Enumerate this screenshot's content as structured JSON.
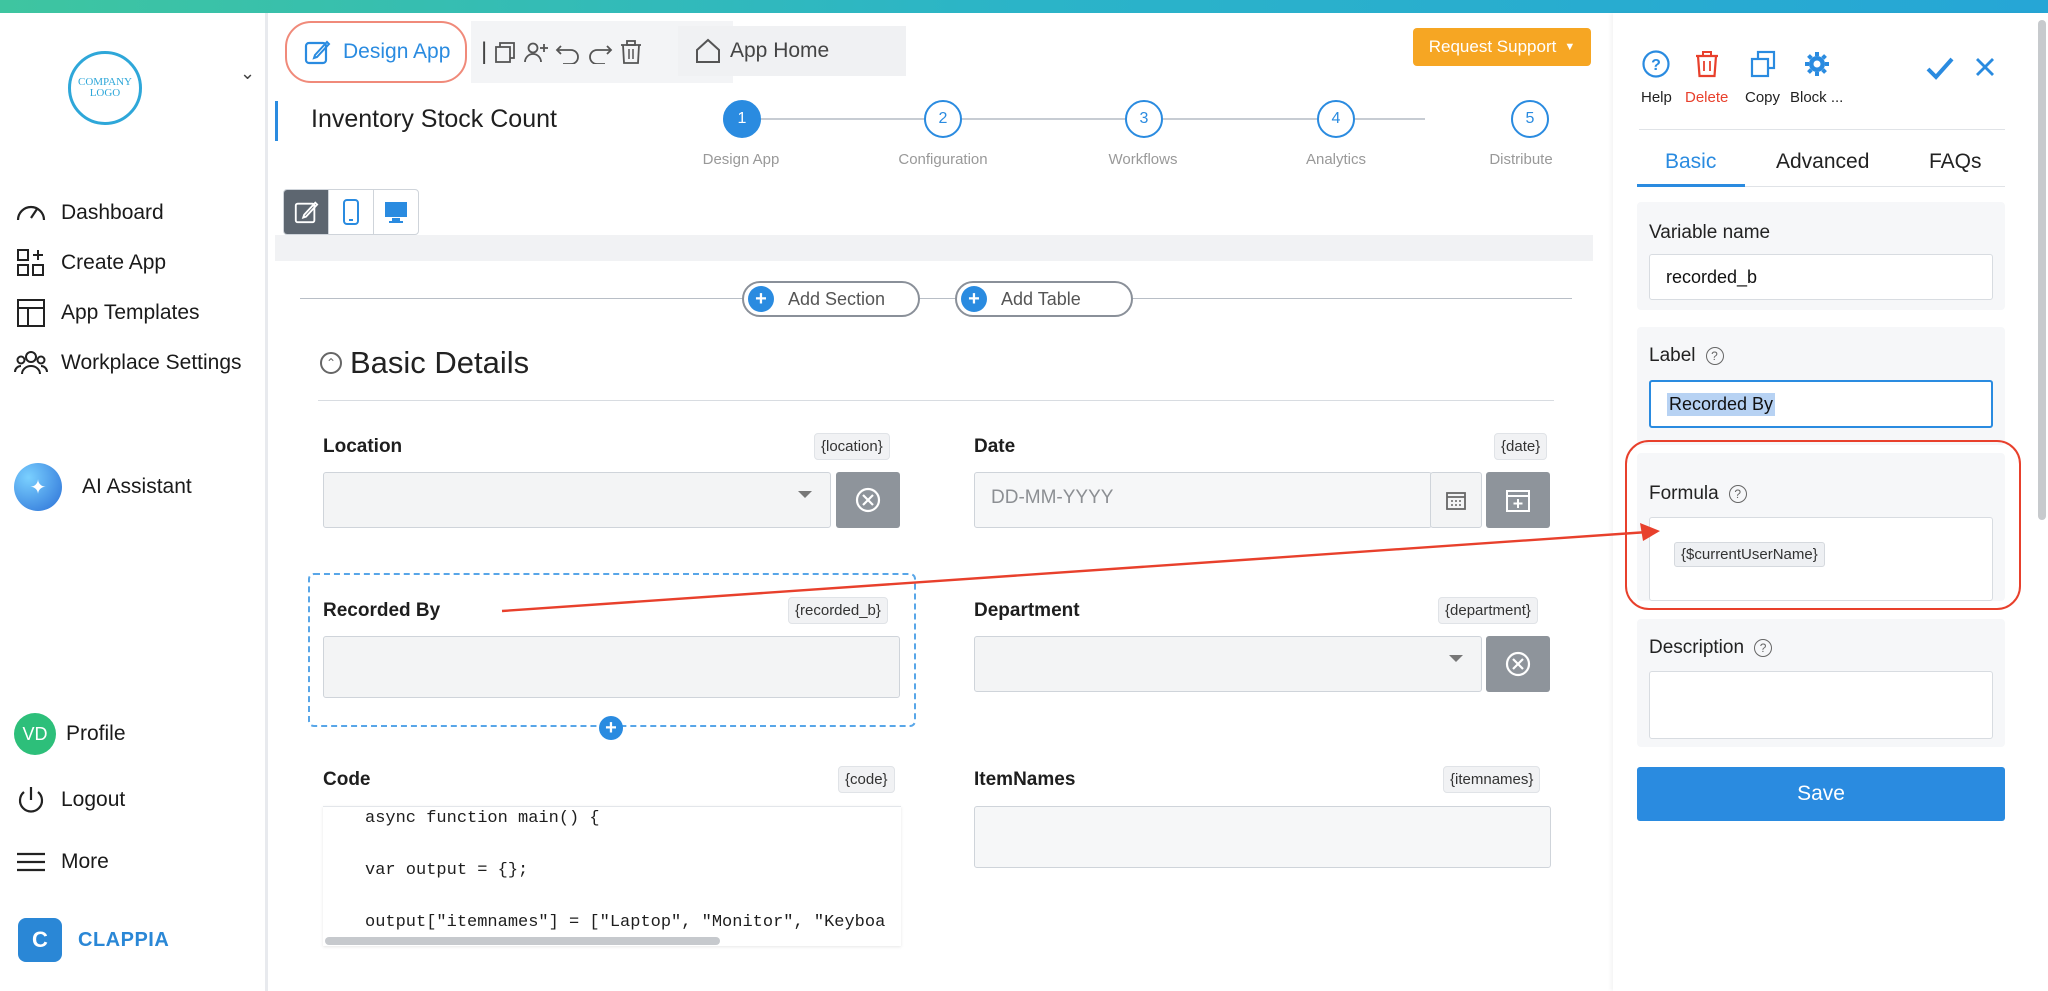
{
  "sidebar": {
    "logo_text": "COMPANY LOGO",
    "items": [
      {
        "label": "Dashboard"
      },
      {
        "label": "Create App"
      },
      {
        "label": "App Templates"
      },
      {
        "label": "Workplace Settings"
      },
      {
        "label": "AI Assistant"
      }
    ],
    "profile": {
      "initials": "VD",
      "label": "Profile"
    },
    "logout": "Logout",
    "more": "More",
    "brand": "CLAPPIA"
  },
  "header": {
    "design_app": "Design App",
    "app_home": "App Home",
    "support": "Request Support",
    "app_title": "Inventory Stock Count",
    "steps": [
      {
        "num": "1",
        "label": "Design App"
      },
      {
        "num": "2",
        "label": "Configuration"
      },
      {
        "num": "3",
        "label": "Workflows"
      },
      {
        "num": "4",
        "label": "Analytics"
      },
      {
        "num": "5",
        "label": "Distribute"
      }
    ]
  },
  "canvas": {
    "add_section": "Add Section",
    "add_table": "Add Table",
    "section_title": "Basic Details",
    "fields": {
      "location": {
        "label": "Location",
        "tag": "{location}"
      },
      "date": {
        "label": "Date",
        "tag": "{date}",
        "placeholder": "DD-MM-YYYY"
      },
      "recorded_by": {
        "label": "Recorded By",
        "tag": "{recorded_b}"
      },
      "department": {
        "label": "Department",
        "tag": "{department}"
      },
      "code": {
        "label": "Code",
        "tag": "{code}"
      },
      "itemnames": {
        "label": "ItemNames",
        "tag": "{itemnames}"
      }
    },
    "code_lines": [
      "async function main() {",
      "var output = {};",
      "output[\"itemnames\"] = [\"Laptop\", \"Monitor\", \"Keyboa"
    ]
  },
  "panel": {
    "tools": [
      {
        "label": "Help",
        "color": "#2a8be0"
      },
      {
        "label": "Delete",
        "color": "#e8402c"
      },
      {
        "label": "Copy",
        "color": "#2a8be0"
      },
      {
        "label": "Block ...",
        "color": "#2a8be0"
      }
    ],
    "tabs": [
      "Basic",
      "Advanced",
      "FAQs"
    ],
    "variable_name": {
      "label": "Variable name",
      "value": "recorded_b"
    },
    "label_field": {
      "label": "Label",
      "value": "Recorded By"
    },
    "formula": {
      "label": "Formula",
      "value": "{$currentUserName}"
    },
    "description": {
      "label": "Description",
      "value": ""
    },
    "save": "Save"
  }
}
